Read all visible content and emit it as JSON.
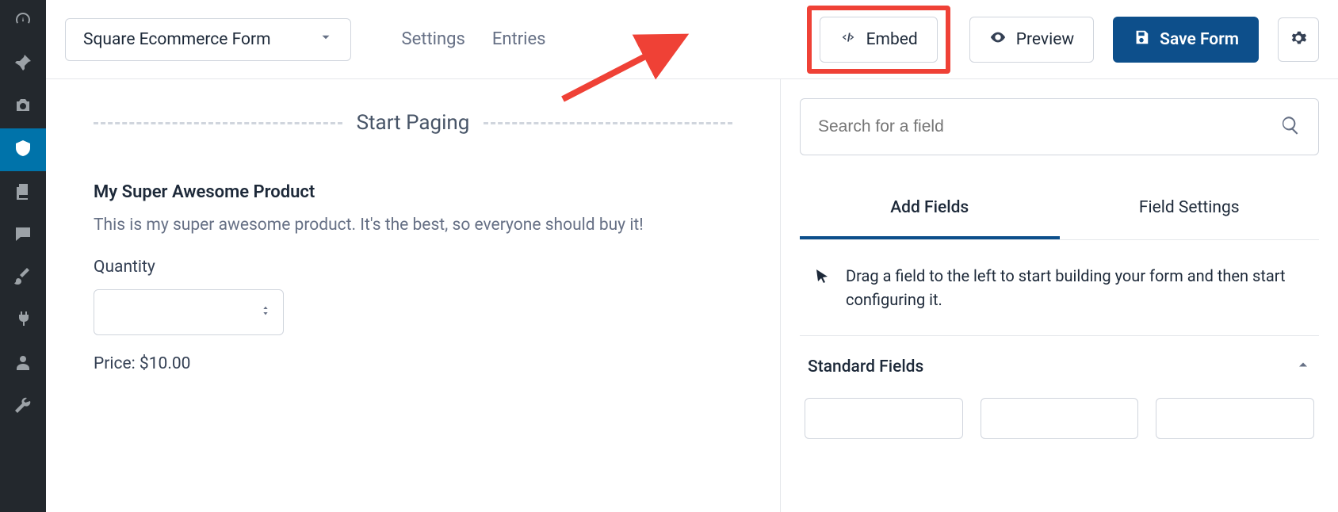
{
  "colors": {
    "primary": "#0d4f8b",
    "highlight": "#ef4136"
  },
  "topbar": {
    "form_name": "Square Ecommerce Form",
    "nav": {
      "settings": "Settings",
      "entries": "Entries"
    },
    "embed_label": "Embed",
    "preview_label": "Preview",
    "save_label": "Save Form"
  },
  "canvas": {
    "paging_label": "Start Paging",
    "product_title": "My Super Awesome Product",
    "product_desc": "This is my super awesome product. It's the best, so everyone should buy it!",
    "qty_label": "Quantity",
    "price_prefix": "Price: ",
    "price_value": "$10.00"
  },
  "panel": {
    "search_placeholder": "Search for a field",
    "tab_add": "Add Fields",
    "tab_settings": "Field Settings",
    "hint": "Drag a field to the left to start building your form and then start configuring it.",
    "section_standard": "Standard Fields"
  }
}
